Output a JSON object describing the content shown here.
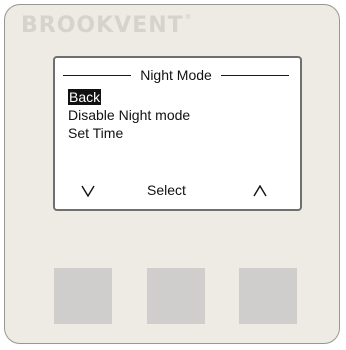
{
  "device": {
    "brand": "BROOKVENT",
    "brand_mark": "®"
  },
  "screen": {
    "title": "Night Mode",
    "menu_items": [
      {
        "label": "Back",
        "selected": true
      },
      {
        "label": "Disable Night mode",
        "selected": false
      },
      {
        "label": "Set Time",
        "selected": false
      }
    ],
    "softkeys": {
      "down_icon": "chevron-down-icon",
      "select_label": "Select",
      "up_icon": "chevron-up-icon"
    }
  },
  "buttons": [
    "left-button",
    "middle-button",
    "right-button"
  ],
  "colors": {
    "panel": "#eeebe4",
    "brand_text": "#d6d3cc",
    "screen_bg": "#ffffff",
    "button": "#cfcecc",
    "highlight": "#111111"
  }
}
